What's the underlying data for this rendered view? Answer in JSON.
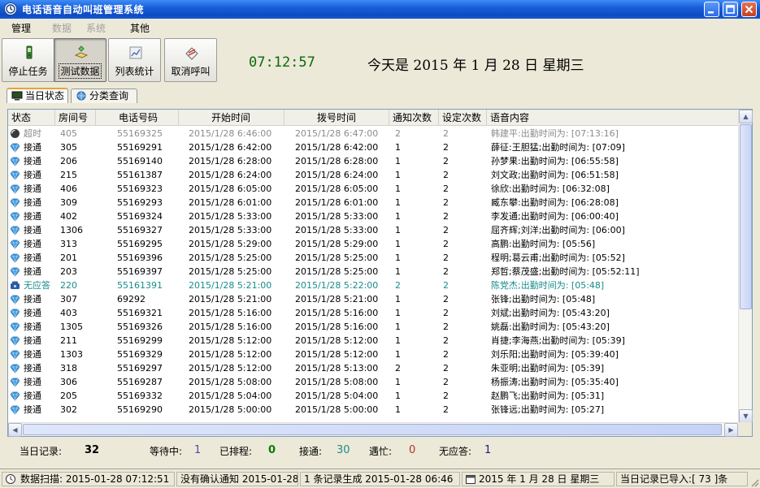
{
  "window": {
    "title": "电话语音自动叫班管理系统"
  },
  "menu": [
    {
      "label": "管理",
      "enabled": true
    },
    {
      "label": "数据",
      "enabled": false
    },
    {
      "label": "系统",
      "enabled": false
    },
    {
      "label": "其他",
      "enabled": true
    }
  ],
  "toolbar": {
    "buttons": [
      {
        "label": "停止任务",
        "icon": "phone-icon"
      },
      {
        "label": "测试数据",
        "icon": "data-icon",
        "pressed": true
      },
      {
        "label": "列表统计",
        "icon": "stats-icon"
      },
      {
        "label": "取消呼叫",
        "icon": "cancel-call-icon"
      }
    ],
    "clock": "07:12:57",
    "today": "今天是 2015 年 1 月 28 日 星期三"
  },
  "tabs": [
    {
      "label": "当日状态",
      "active": true
    },
    {
      "label": "分类查询",
      "active": false
    }
  ],
  "table": {
    "columns": [
      "状态",
      "房间号",
      "电话号码",
      "开始时间",
      "拨号时间",
      "通知次数",
      "设定次数",
      "语音内容"
    ],
    "rows": [
      {
        "status": "超时",
        "kind": "timeout",
        "room": "405",
        "phone": "55169325",
        "start": "2015/1/28 6:46:00",
        "dial": "2015/1/28 6:47:00",
        "notify": "2",
        "set": "2",
        "voice": "韩建平:出勤时间为: [07:13:16]"
      },
      {
        "status": "接通",
        "kind": "ok",
        "room": "305",
        "phone": "55169291",
        "start": "2015/1/28 6:42:00",
        "dial": "2015/1/28 6:42:00",
        "notify": "1",
        "set": "2",
        "voice": "薛征:王胆猛;出勤时间为: [07:09]"
      },
      {
        "status": "接通",
        "kind": "ok",
        "room": "206",
        "phone": "55169140",
        "start": "2015/1/28 6:28:00",
        "dial": "2015/1/28 6:28:00",
        "notify": "1",
        "set": "2",
        "voice": "孙梦果:出勤时间为: [06:55:58]"
      },
      {
        "status": "接通",
        "kind": "ok",
        "room": "215",
        "phone": "55161387",
        "start": "2015/1/28 6:24:00",
        "dial": "2015/1/28 6:24:00",
        "notify": "1",
        "set": "2",
        "voice": "刘文政;出勤时间为: [06:51:58]"
      },
      {
        "status": "接通",
        "kind": "ok",
        "room": "406",
        "phone": "55169323",
        "start": "2015/1/28 6:05:00",
        "dial": "2015/1/28 6:05:00",
        "notify": "1",
        "set": "2",
        "voice": "徐欣:出勤时间为: [06:32:08]"
      },
      {
        "status": "接通",
        "kind": "ok",
        "room": "309",
        "phone": "55169293",
        "start": "2015/1/28 6:01:00",
        "dial": "2015/1/28 6:01:00",
        "notify": "1",
        "set": "2",
        "voice": "臧东攀:出勤时间为: [06:28:08]"
      },
      {
        "status": "接通",
        "kind": "ok",
        "room": "402",
        "phone": "55169324",
        "start": "2015/1/28 5:33:00",
        "dial": "2015/1/28 5:33:00",
        "notify": "1",
        "set": "2",
        "voice": "李发通;出勤时间为: [06:00:40]"
      },
      {
        "status": "接通",
        "kind": "ok",
        "room": "1306",
        "phone": "55169327",
        "start": "2015/1/28 5:33:00",
        "dial": "2015/1/28 5:33:00",
        "notify": "1",
        "set": "2",
        "voice": "屈齐辉;刘洋;出勤时间为: [06:00]"
      },
      {
        "status": "接通",
        "kind": "ok",
        "room": "313",
        "phone": "55169295",
        "start": "2015/1/28 5:29:00",
        "dial": "2015/1/28 5:29:00",
        "notify": "1",
        "set": "2",
        "voice": "高鹏:出勤时间为: [05:56]"
      },
      {
        "status": "接通",
        "kind": "ok",
        "room": "201",
        "phone": "55169396",
        "start": "2015/1/28 5:25:00",
        "dial": "2015/1/28 5:25:00",
        "notify": "1",
        "set": "2",
        "voice": "程明;葛云甫;出勤时间为: [05:52]"
      },
      {
        "status": "接通",
        "kind": "ok",
        "room": "203",
        "phone": "55169397",
        "start": "2015/1/28 5:25:00",
        "dial": "2015/1/28 5:25:00",
        "notify": "1",
        "set": "2",
        "voice": "郑哲;蔡茂盛;出勤时间为: [05:52:11]"
      },
      {
        "status": "无应答",
        "kind": "noanswer",
        "room": "220",
        "phone": "55161391",
        "start": "2015/1/28 5:21:00",
        "dial": "2015/1/28 5:22:00",
        "notify": "2",
        "set": "2",
        "voice": "陈党杰;出勤时间为: [05:48]"
      },
      {
        "status": "接通",
        "kind": "ok",
        "room": "307",
        "phone": "69292",
        "start": "2015/1/28 5:21:00",
        "dial": "2015/1/28 5:21:00",
        "notify": "1",
        "set": "2",
        "voice": "张锋;出勤时间为: [05:48]"
      },
      {
        "status": "接通",
        "kind": "ok",
        "room": "403",
        "phone": "55169321",
        "start": "2015/1/28 5:16:00",
        "dial": "2015/1/28 5:16:00",
        "notify": "1",
        "set": "2",
        "voice": "刘斌;出勤时间为: [05:43:20]"
      },
      {
        "status": "接通",
        "kind": "ok",
        "room": "1305",
        "phone": "55169326",
        "start": "2015/1/28 5:16:00",
        "dial": "2015/1/28 5:16:00",
        "notify": "1",
        "set": "2",
        "voice": "姚磊:出勤时间为: [05:43:20]"
      },
      {
        "status": "接通",
        "kind": "ok",
        "room": "211",
        "phone": "55169299",
        "start": "2015/1/28 5:12:00",
        "dial": "2015/1/28 5:12:00",
        "notify": "1",
        "set": "2",
        "voice": "肖捷;李海燕;出勤时间为: [05:39]"
      },
      {
        "status": "接通",
        "kind": "ok",
        "room": "1303",
        "phone": "55169329",
        "start": "2015/1/28 5:12:00",
        "dial": "2015/1/28 5:12:00",
        "notify": "1",
        "set": "2",
        "voice": "刘乐阳;出勤时间为: [05:39:40]"
      },
      {
        "status": "接通",
        "kind": "ok",
        "room": "318",
        "phone": "55169297",
        "start": "2015/1/28 5:12:00",
        "dial": "2015/1/28 5:13:00",
        "notify": "2",
        "set": "2",
        "voice": "朱亚明;出勤时间为: [05:39]"
      },
      {
        "status": "接通",
        "kind": "ok",
        "room": "306",
        "phone": "55169287",
        "start": "2015/1/28 5:08:00",
        "dial": "2015/1/28 5:08:00",
        "notify": "1",
        "set": "2",
        "voice": "杨振涛;出勤时间为: [05:35:40]"
      },
      {
        "status": "接通",
        "kind": "ok",
        "room": "205",
        "phone": "55169332",
        "start": "2015/1/28 5:04:00",
        "dial": "2015/1/28 5:04:00",
        "notify": "1",
        "set": "2",
        "voice": "赵鹏飞;出勤时间为: [05:31]"
      },
      {
        "status": "接通",
        "kind": "ok",
        "room": "302",
        "phone": "55169290",
        "start": "2015/1/28 5:00:00",
        "dial": "2015/1/28 5:00:00",
        "notify": "1",
        "set": "2",
        "voice": "张锋远;出勤时间为: [05:27]"
      }
    ]
  },
  "summary": {
    "today_label": "当日记录:",
    "today_value": "32",
    "waiting_label": "等待中:",
    "waiting_value": "1",
    "queued_label": "已排程:",
    "queued_value": "0",
    "connected_label": "接通:",
    "connected_value": "30",
    "busy_label": "遇忙:",
    "busy_value": "0",
    "noanswer_label": "无应答:",
    "noanswer_value": "1"
  },
  "statusbar": {
    "scan": "数据扫描: 2015-01-28 07:12:51",
    "confirm": "没有确认通知 2015-01-28",
    "generated": "1 条记录生成 2015-01-28 06:46",
    "date": "2015 年 1 月 28 日 星期三",
    "imported": "当日记录已导入:[ 73 ]条"
  },
  "colors": {
    "clock": "#0a6a0a",
    "timeout_row": "#8c8c8c",
    "noanswer_row": "#1a8c8c",
    "waiting": "#4d4d9d",
    "queued": "#0a7a0a",
    "connected": "#1a8c8c",
    "busy": "#b03030",
    "noanswer": "#1a1a8c"
  }
}
